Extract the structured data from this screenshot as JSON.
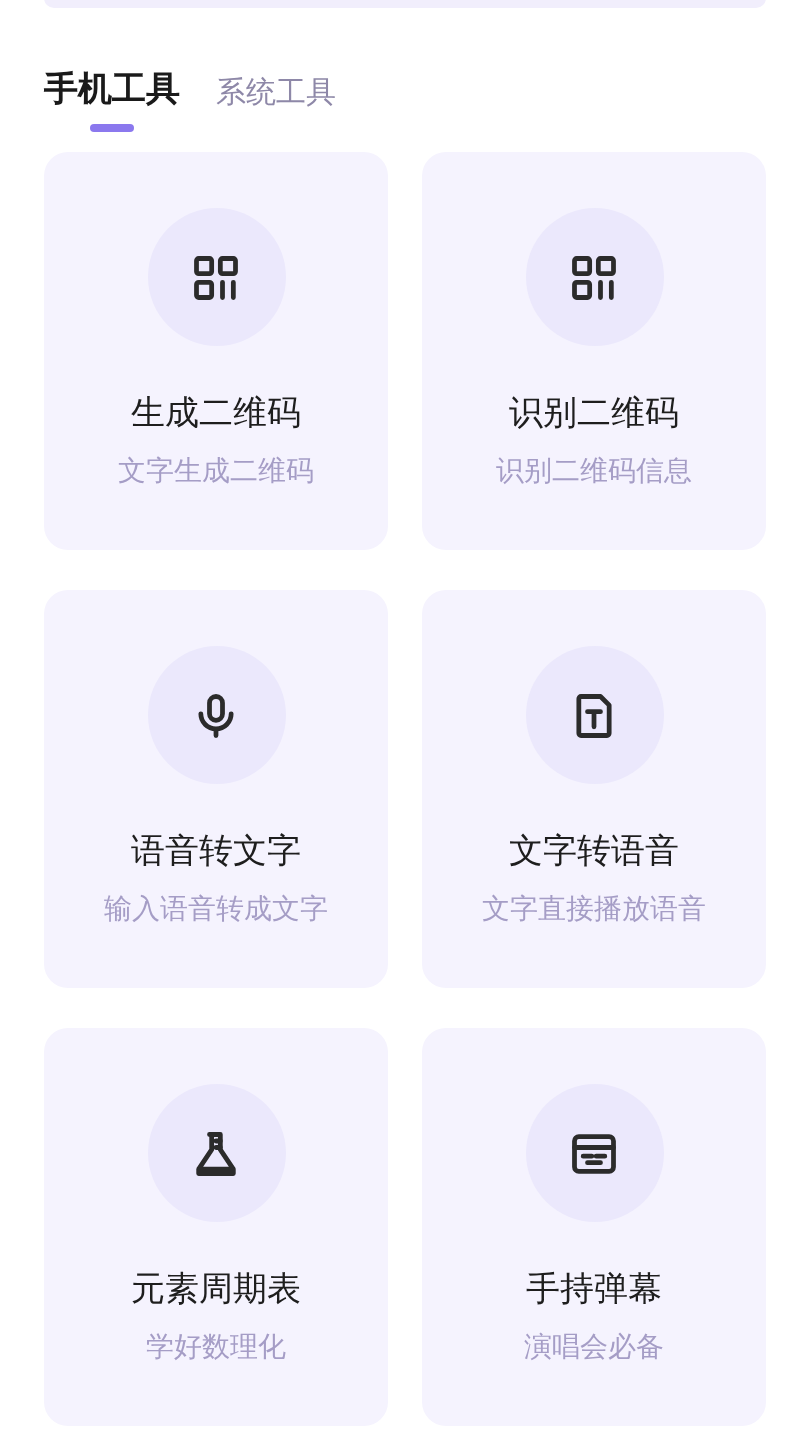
{
  "tabs": [
    {
      "label": "手机工具",
      "selected": true
    },
    {
      "label": "系统工具",
      "selected": false
    }
  ],
  "tools": [
    {
      "kind": "qr",
      "title": "生成二维码",
      "subtitle": "文字生成二维码"
    },
    {
      "kind": "qr",
      "title": "识别二维码",
      "subtitle": "识别二维码信息"
    },
    {
      "kind": "mic",
      "title": "语音转文字",
      "subtitle": "输入语音转成文字"
    },
    {
      "kind": "text",
      "title": "文字转语音",
      "subtitle": "文字直接播放语音"
    },
    {
      "kind": "flask",
      "title": "元素周期表",
      "subtitle": "学好数理化"
    },
    {
      "kind": "danmaku",
      "title": "手持弹幕",
      "subtitle": "演唱会必备"
    }
  ]
}
